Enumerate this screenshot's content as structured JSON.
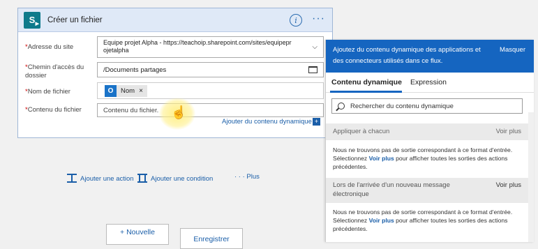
{
  "card": {
    "title": "Créer un fichier",
    "sp_letter": "S",
    "info_glyph": "i",
    "more_glyph": "···",
    "fields": [
      {
        "label": "Adresse du site",
        "value_line1": "Equipe projet Alpha - https://teachoip.sharepoint.com/sites/equipepr",
        "value_line2": "ojetalpha"
      },
      {
        "label": "Chemin d'accès du dossier",
        "value": "/Documents partages"
      },
      {
        "label": "Nom de fichier",
        "token": "Nom",
        "token_x": "×"
      },
      {
        "label": "Contenu du fichier",
        "placeholder": "Contenu du fichier."
      }
    ],
    "required_mark": "*",
    "dynamic_link": "Ajouter du contenu dynamique",
    "dynamic_plus": "+"
  },
  "actions": {
    "add_action": "Ajouter une action",
    "add_condition": "Ajouter une condition",
    "more": "· · ·  Plus"
  },
  "buttons": {
    "new": "+ Nouvelle",
    "save": "Enregistrer"
  },
  "panel": {
    "description": "Ajoutez du contenu dynamique des applications et des connecteurs utilisés dans ce flux.",
    "hide": "Masquer",
    "tabs": [
      "Contenu dynamique",
      "Expression"
    ],
    "search_placeholder": "Rechercher du contenu dynamique",
    "sections": [
      {
        "title": "Appliquer à chacun",
        "see_more": "Voir plus",
        "body_before": "Nous ne trouvons pas de sortie correspondant à ce format d'entrée. Sélectionnez ",
        "body_link": "Voir plus",
        "body_after": " pour afficher toutes les sorties des actions précédentes."
      },
      {
        "title": "Lors de l'arrivée d'un nouveau message électronique",
        "see_more": "Voir plus",
        "body_before": "Nous ne trouvons pas de sortie correspondant à ce format d'entrée. Sélectionnez ",
        "body_link": "Voir plus",
        "body_after": " pour afficher toutes les sorties des actions précédentes."
      }
    ]
  },
  "colors": {
    "accent": "#1565c0",
    "link": "#1a5ea8",
    "header_bg": "#dfe9f7"
  }
}
